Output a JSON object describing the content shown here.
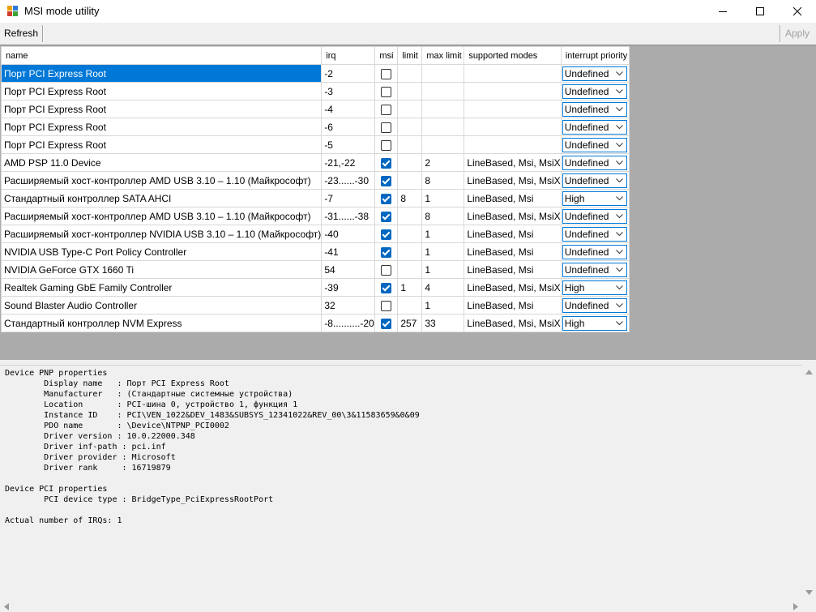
{
  "window": {
    "title": "MSI mode utility"
  },
  "toolbar": {
    "refresh_label": "Refresh",
    "apply_label": "Apply"
  },
  "columns": [
    "name",
    "irq",
    "msi",
    "limit",
    "max limit",
    "supported modes",
    "interrupt priority"
  ],
  "rows": [
    {
      "name": "Порт PCI Express Root",
      "irq": "-2",
      "msi": false,
      "limit": "",
      "max_limit": "",
      "modes": "",
      "priority": "Undefined"
    },
    {
      "name": "Порт PCI Express Root",
      "irq": "-3",
      "msi": false,
      "limit": "",
      "max_limit": "",
      "modes": "",
      "priority": "Undefined"
    },
    {
      "name": "Порт PCI Express Root",
      "irq": "-4",
      "msi": false,
      "limit": "",
      "max_limit": "",
      "modes": "",
      "priority": "Undefined"
    },
    {
      "name": "Порт PCI Express Root",
      "irq": "-6",
      "msi": false,
      "limit": "",
      "max_limit": "",
      "modes": "",
      "priority": "Undefined"
    },
    {
      "name": "Порт PCI Express Root",
      "irq": "-5",
      "msi": false,
      "limit": "",
      "max_limit": "",
      "modes": "",
      "priority": "Undefined"
    },
    {
      "name": "AMD PSP 11.0 Device",
      "irq": "-21,-22",
      "msi": true,
      "limit": "",
      "max_limit": "2",
      "modes": "LineBased, Msi, MsiX",
      "priority": "Undefined"
    },
    {
      "name": "Расширяемый хост-контроллер AMD USB 3.10 – 1.10 (Майкрософт)",
      "irq": "-23......-30",
      "msi": true,
      "limit": "",
      "max_limit": "8",
      "modes": "LineBased, Msi, MsiX",
      "priority": "Undefined"
    },
    {
      "name": "Стандартный контроллер SATA AHCI",
      "irq": "-7",
      "msi": true,
      "limit": "8",
      "max_limit": "1",
      "modes": "LineBased, Msi",
      "priority": "High"
    },
    {
      "name": "Расширяемый хост-контроллер AMD USB 3.10 – 1.10 (Майкрософт)",
      "irq": "-31......-38",
      "msi": true,
      "limit": "",
      "max_limit": "8",
      "modes": "LineBased, Msi, MsiX",
      "priority": "Undefined"
    },
    {
      "name": "Расширяемый хост-контроллер NVIDIA USB 3.10 – 1.10 (Майкрософт)",
      "irq": "-40",
      "msi": true,
      "limit": "",
      "max_limit": "1",
      "modes": "LineBased, Msi",
      "priority": "Undefined"
    },
    {
      "name": "NVIDIA USB Type-C Port Policy Controller",
      "irq": "-41",
      "msi": true,
      "limit": "",
      "max_limit": "1",
      "modes": "LineBased, Msi",
      "priority": "Undefined"
    },
    {
      "name": "NVIDIA GeForce GTX 1660 Ti",
      "irq": "54",
      "msi": false,
      "limit": "",
      "max_limit": "1",
      "modes": "LineBased, Msi",
      "priority": "Undefined"
    },
    {
      "name": "Realtek Gaming GbE Family Controller",
      "irq": "-39",
      "msi": true,
      "limit": "1",
      "max_limit": "4",
      "modes": "LineBased, Msi, MsiX",
      "priority": "High"
    },
    {
      "name": "Sound Blaster Audio Controller",
      "irq": "32",
      "msi": false,
      "limit": "",
      "max_limit": "1",
      "modes": "LineBased, Msi",
      "priority": "Undefined"
    },
    {
      "name": "Стандартный контроллер NVM Express",
      "irq": "-8..........-20",
      "msi": true,
      "limit": "257",
      "max_limit": "33",
      "modes": "LineBased, Msi, MsiX",
      "priority": "High"
    }
  ],
  "selected_row": 0,
  "properties": {
    "text": "Device PNP properties\n        Display name   : Порт PCI Express Root\n        Manufacturer   : (Стандартные системные устройства)\n        Location       : PCI-шина 0, устройство 1, функция 1\n        Instance ID    : PCI\\VEN_1022&DEV_1483&SUBSYS_12341022&REV_00\\3&11583659&0&09\n        PDO name       : \\Device\\NTPNP_PCI0002\n        Driver version : 10.0.22000.348\n        Driver inf-path : pci.inf\n        Driver provider : Microsoft\n        Driver rank     : 16719879\n\nDevice PCI properties\n        PCI device type : BridgeType_PciExpressRootPort\n\nActual number of IRQs: 1"
  }
}
